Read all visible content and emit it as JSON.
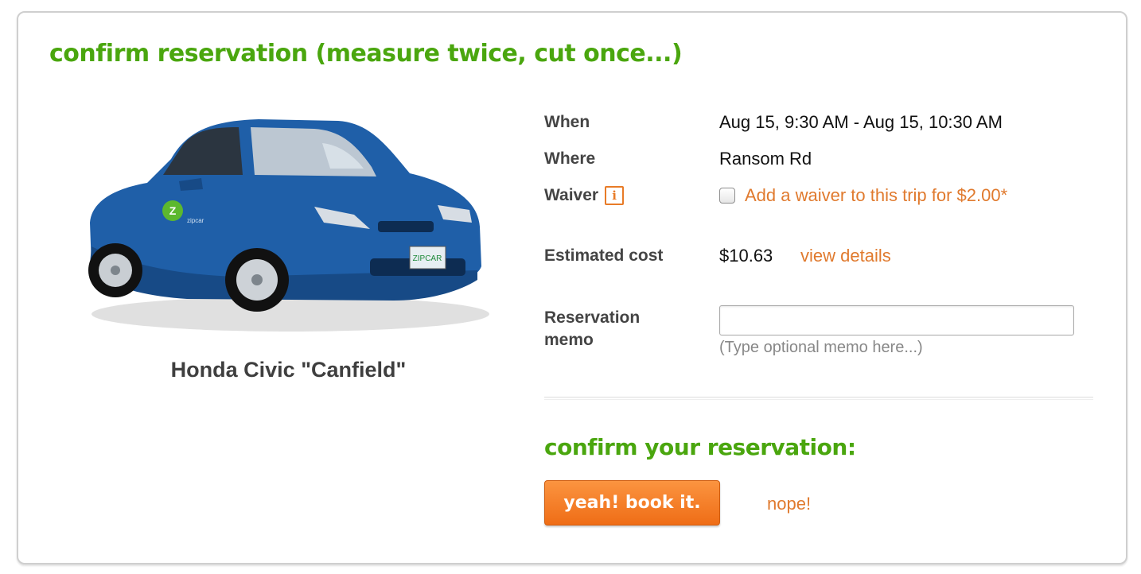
{
  "header": {
    "title": "confirm reservation (measure twice, cut once...)"
  },
  "vehicle": {
    "name": "Honda Civic \"Canfield\"",
    "plate_text": "ZIPCAR",
    "decal_text": "zipcar"
  },
  "details": {
    "when": {
      "label": "When",
      "value": "Aug 15, 9:30 AM - Aug 15, 10:30 AM"
    },
    "where": {
      "label": "Where",
      "value": "Ransom Rd"
    },
    "waiver": {
      "label": "Waiver",
      "info_icon": "i",
      "checkbox_label": "Add a waiver to this trip for $2.00*",
      "checked": false
    },
    "cost": {
      "label": "Estimated cost",
      "value": "$10.63",
      "link": "view details"
    },
    "memo": {
      "label_line1": "Reservation",
      "label_line2": "memo",
      "value": "",
      "hint": "(Type optional memo here...)"
    }
  },
  "confirm": {
    "heading": "confirm your reservation:",
    "book_label": "yeah! book it.",
    "cancel_label": "nope!"
  },
  "colors": {
    "green": "#4aa60e",
    "orange": "#e07a2e",
    "button": "#f57f22",
    "car_blue": "#1f5fa8"
  },
  "icons": {
    "info": "info-icon"
  }
}
